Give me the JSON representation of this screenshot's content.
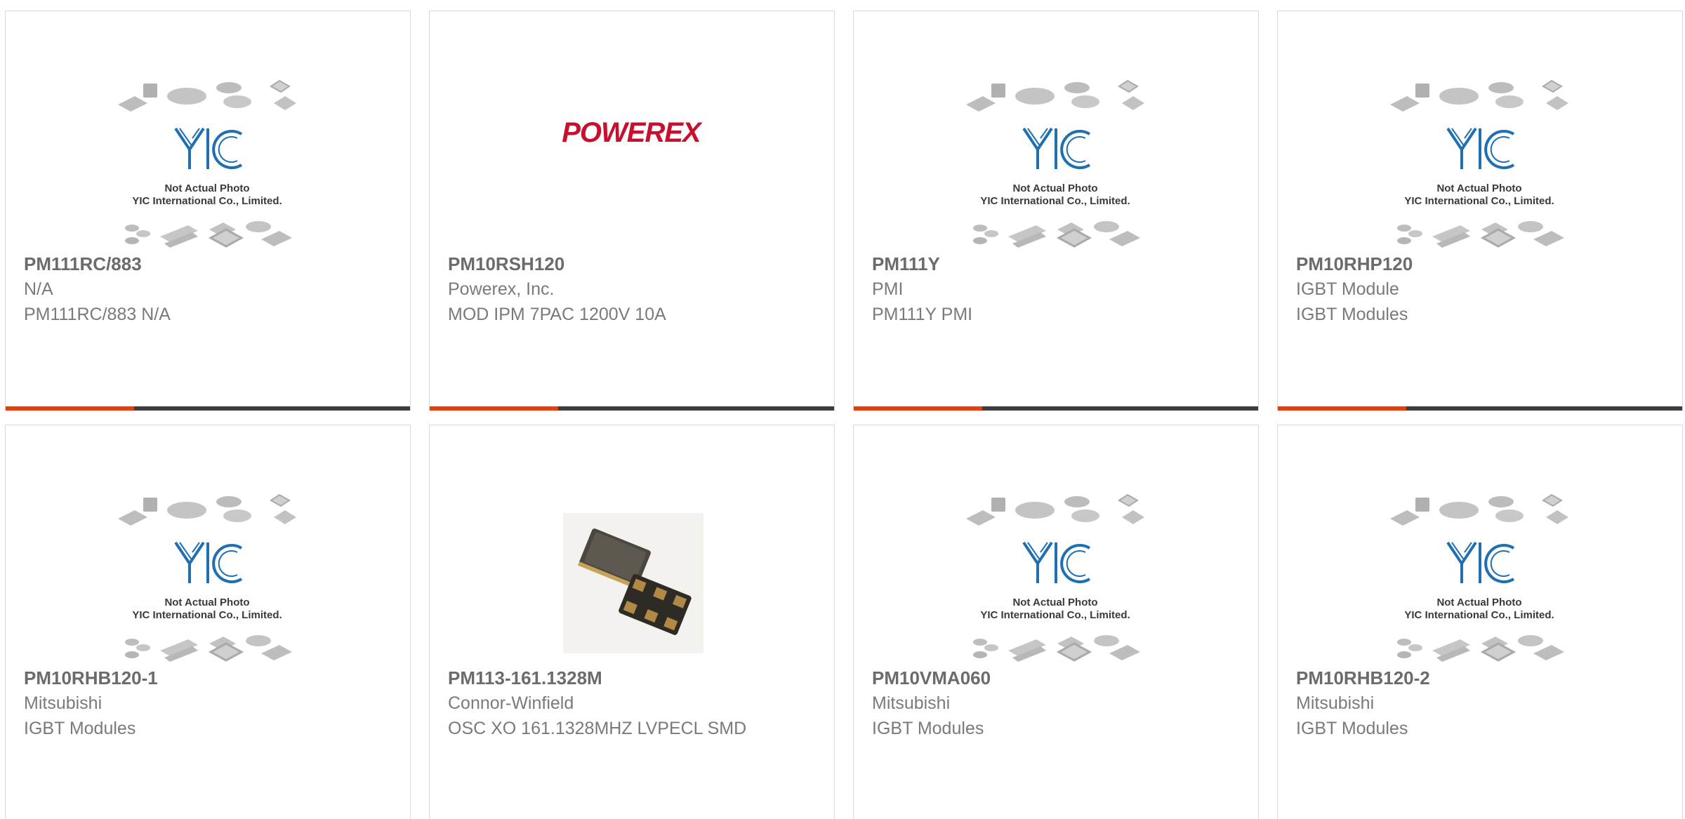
{
  "placeholder_caption": [
    "Not Actual Photo",
    "YIC International Co., Limited."
  ],
  "placeholder_logo": "YIC",
  "brand_logo": "POWEREX",
  "colors": {
    "accent": "#e8400c",
    "bar": "#3d3d3d",
    "powerex": "#c8102e",
    "yic_blue": "#1f6fb3"
  },
  "products": [
    {
      "part": "PM111RC/883",
      "manufacturer": "N/A",
      "description": "PM111RC/883 N/A",
      "image": "yic-placeholder"
    },
    {
      "part": "PM10RSH120",
      "manufacturer": "Powerex, Inc.",
      "description": "MOD IPM 7PAC 1200V 10A",
      "image": "powerex-logo"
    },
    {
      "part": "PM111Y",
      "manufacturer": "PMI",
      "description": "PM111Y PMI",
      "image": "yic-placeholder"
    },
    {
      "part": "PM10RHP120",
      "manufacturer": "IGBT Module",
      "description": "IGBT Modules",
      "image": "yic-placeholder"
    },
    {
      "part": "PM10RHB120-1",
      "manufacturer": "Mitsubishi",
      "description": "IGBT Modules",
      "image": "yic-placeholder"
    },
    {
      "part": "PM113-161.1328M",
      "manufacturer": "Connor-Winfield",
      "description": "OSC XO 161.1328MHZ LVPECL SMD",
      "image": "oscillator-photo"
    },
    {
      "part": "PM10VMA060",
      "manufacturer": "Mitsubishi",
      "description": "IGBT Modules",
      "image": "yic-placeholder"
    },
    {
      "part": "PM10RHB120-2",
      "manufacturer": "Mitsubishi",
      "description": "IGBT Modules",
      "image": "yic-placeholder"
    }
  ]
}
